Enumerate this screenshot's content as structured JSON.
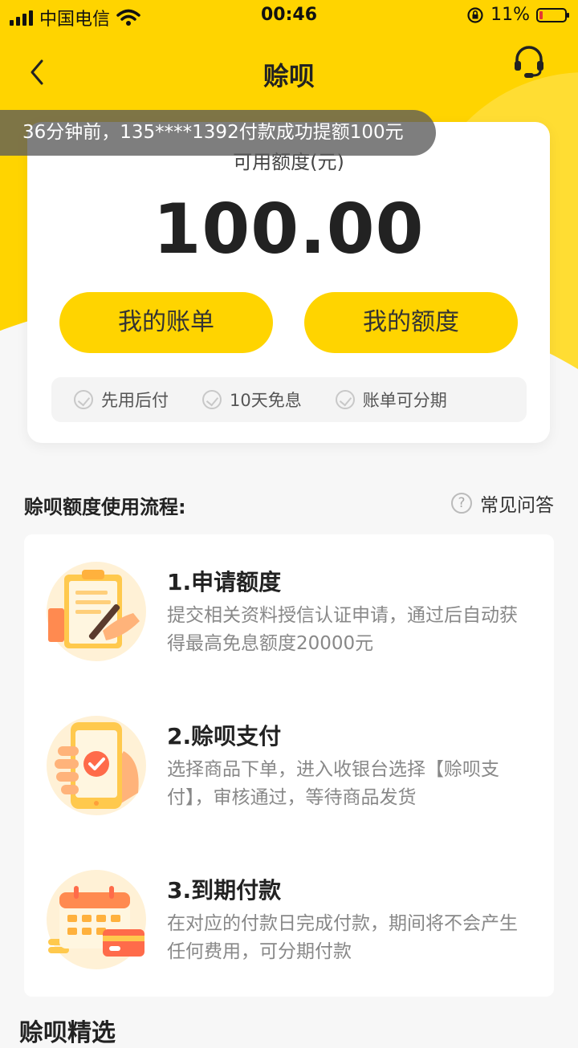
{
  "status_bar": {
    "carrier": "中国电信",
    "time": "00:46",
    "battery": "11%"
  },
  "nav": {
    "title": "赊呗",
    "back_icon": "chevron-left-icon",
    "service_icon": "headset-icon"
  },
  "notice": "36分钟前，135****1392付款成功提额100元",
  "credit": {
    "label": "可用额度(元)",
    "amount": "100.00",
    "bill_button": "我的账单",
    "quota_button": "我的额度",
    "features": [
      "先用后付",
      "10天免息",
      "账单可分期"
    ]
  },
  "process": {
    "title": "赊呗额度使用流程:",
    "faq_label": "常见问答",
    "steps": [
      {
        "title": "1.申请额度",
        "desc": "提交相关资料授信认证申请，通过后自动获得最高免息额度20000元",
        "icon": "clipboard-sign-icon"
      },
      {
        "title": "2.赊呗支付",
        "desc": "选择商品下单，进入收银台选择【赊呗支付】，审核通过，等待商品发货",
        "icon": "phone-pay-icon"
      },
      {
        "title": "3.到期付款",
        "desc": "在对应的付款日完成付款，期间将不会产生任何费用，可分期付款",
        "icon": "calendar-card-icon"
      }
    ]
  },
  "bottom_section_title": "赊呗精选",
  "colors": {
    "brand_yellow": "#ffd400",
    "background": "#f7f7f7",
    "battery_low": "#e53935"
  }
}
